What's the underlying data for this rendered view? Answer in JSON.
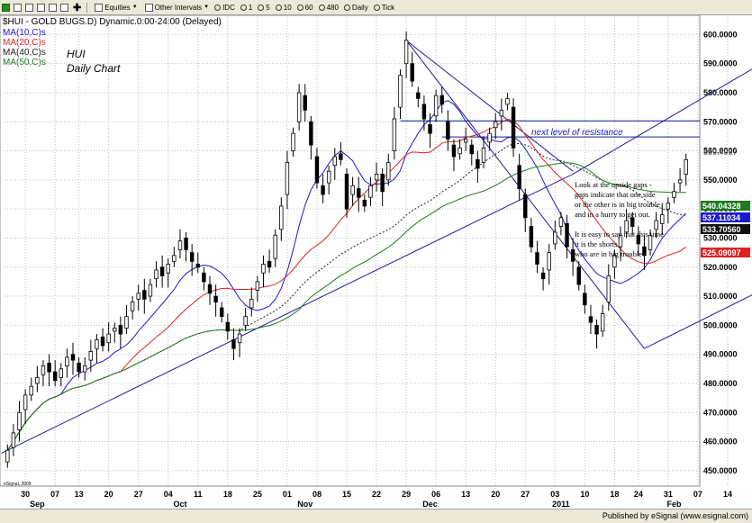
{
  "toolbar": {
    "equities": "Equities",
    "other_intervals": "Other Intervals",
    "intervals": [
      "IDC",
      "1",
      "5",
      "10",
      "60",
      "480",
      "Daily",
      "Tick"
    ]
  },
  "status_text": "Published by eSignal (www.esignal.com)",
  "colors": {
    "ma10": "#1a1acc",
    "ma20": "#dd2222",
    "ma40": "#222222",
    "ma50": "#1e7a1e",
    "trend": "#1a1a99",
    "annotation": "#1a1acc",
    "candle": "#000000",
    "badge_ma50": "#1e7a1e",
    "badge_ma10": "#1a1acc",
    "badge_ma40": "#111111",
    "badge_ma20": "#dd2222"
  },
  "chart_data": {
    "type": "candlestick",
    "title": "$HUI - GOLD BUGS.D) Dynamic.0:00-24:00 (Delayed)",
    "legend": [
      "MA(10,C)s",
      "MA(20,C)s",
      "MA(40,C)s",
      "MA(50,C)s"
    ],
    "symbol_label": "HUI",
    "chart_label": "Daily Chart",
    "ylim": [
      445,
      606
    ],
    "y_ticks": [
      450,
      460,
      470,
      480,
      490,
      500,
      510,
      520,
      530,
      540,
      550,
      560,
      570,
      580,
      590,
      600
    ],
    "y_tick_labels": [
      "450.0000",
      "460.0000",
      "470.0000",
      "480.0000",
      "490.0000",
      "500.0000",
      "510.0000",
      "520.0000",
      "530.0000",
      "540.0000",
      "550.0000",
      "560.0000",
      "570.0000",
      "580.0000",
      "590.0000",
      "600.0000"
    ],
    "last_price_label": "559.4957",
    "x_ticks": [
      {
        "label": "30",
        "i": 3
      },
      {
        "label": "07",
        "i": 8
      },
      {
        "label": "13",
        "i": 12
      },
      {
        "label": "20",
        "i": 17
      },
      {
        "label": "27",
        "i": 22
      },
      {
        "label": "04",
        "i": 27
      },
      {
        "label": "11",
        "i": 32
      },
      {
        "label": "18",
        "i": 37
      },
      {
        "label": "25",
        "i": 42
      },
      {
        "label": "01",
        "i": 47
      },
      {
        "label": "08",
        "i": 52
      },
      {
        "label": "15",
        "i": 57
      },
      {
        "label": "22",
        "i": 62
      },
      {
        "label": "29",
        "i": 67
      },
      {
        "label": "06",
        "i": 72
      },
      {
        "label": "13",
        "i": 77
      },
      {
        "label": "20",
        "i": 82
      },
      {
        "label": "27",
        "i": 87
      },
      {
        "label": "03",
        "i": 92
      },
      {
        "label": "10",
        "i": 97
      },
      {
        "label": "18",
        "i": 102
      },
      {
        "label": "24",
        "i": 106
      },
      {
        "label": "31",
        "i": 111
      },
      {
        "label": "07",
        "i": 116
      },
      {
        "label": "14",
        "i": 121
      }
    ],
    "month_labels": [
      {
        "label": "Sep",
        "i": 5
      },
      {
        "label": "Oct",
        "i": 29
      },
      {
        "label": "Nov",
        "i": 50
      },
      {
        "label": "Dec",
        "i": 71
      },
      {
        "label": "2011",
        "i": 93
      },
      {
        "label": "Feb",
        "i": 112
      }
    ],
    "badges": [
      {
        "label": "540.04328",
        "value": 540.04
      },
      {
        "label": "537.11034",
        "value": 537.11
      },
      {
        "label": "533.70560",
        "value": 533.71
      },
      {
        "label": "525.09097",
        "value": 525.09
      }
    ],
    "annotations": {
      "resistance": "next level of resistance",
      "gaps": [
        "Look at the upside gaps -",
        "gaps indicate that one side",
        "or the other is in big trouble",
        "and in a hurry to get out.",
        "",
        "It is easy to say that this time",
        "it is the shorts",
        "who are in big trouble"
      ],
      "copyright": "eSignal, 2009"
    },
    "resistance_levels": [
      570.3,
      564.8
    ],
    "closes": [
      457,
      463,
      470,
      476,
      479,
      482,
      486,
      484,
      481,
      485,
      489,
      488,
      484,
      486,
      491,
      495,
      493,
      497,
      499,
      497,
      503,
      508,
      511,
      509,
      514,
      519,
      517,
      521,
      524,
      529,
      526,
      522,
      520,
      515,
      511,
      508,
      503,
      498,
      492,
      497,
      503,
      509,
      515,
      521,
      520,
      531,
      541,
      556,
      566,
      580,
      574,
      562,
      549,
      545,
      553,
      558,
      557,
      540,
      548,
      544,
      541,
      548,
      552,
      546,
      556,
      571,
      586,
      598,
      584,
      578,
      571,
      566,
      579,
      576,
      564,
      558,
      561,
      564,
      559,
      554,
      561,
      566,
      570,
      574,
      578,
      561,
      547,
      537,
      527,
      521,
      516,
      525,
      532,
      537,
      527,
      522,
      514,
      507,
      501,
      497,
      504,
      517,
      524,
      531,
      536,
      534,
      528,
      524,
      531,
      536,
      538,
      542,
      546,
      550,
      557
    ],
    "opens": [
      453,
      458,
      464,
      471,
      476,
      480,
      483,
      487,
      484,
      482,
      486,
      490,
      487,
      484,
      488,
      492,
      496,
      494,
      498,
      500,
      499,
      505,
      509,
      512,
      510,
      516,
      520,
      518,
      522,
      526,
      530,
      525,
      521,
      518,
      514,
      510,
      506,
      501,
      495,
      494,
      500,
      506,
      512,
      518,
      522,
      523,
      533,
      545,
      560,
      570,
      579,
      570,
      558,
      548,
      549,
      555,
      559,
      552,
      545,
      547,
      543,
      544,
      550,
      552,
      550,
      560,
      575,
      590,
      590,
      580,
      576,
      569,
      572,
      579,
      570,
      562,
      559,
      563,
      562,
      557,
      556,
      563,
      568,
      572,
      576,
      575,
      555,
      545,
      534,
      525,
      518,
      519,
      528,
      534,
      535,
      526,
      520,
      511,
      503,
      500,
      498,
      508,
      520,
      527,
      532,
      537,
      531,
      527,
      526,
      533,
      535,
      540,
      544,
      549,
      552
    ]
  }
}
